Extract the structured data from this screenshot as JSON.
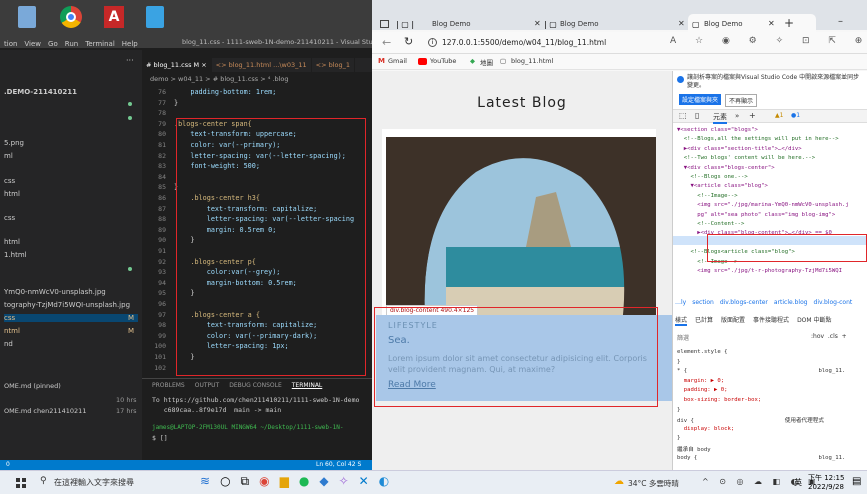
{
  "vscode": {
    "menu": [
      "tion",
      "View",
      "Go",
      "Run",
      "Terminal",
      "Help"
    ],
    "window_title": "blog_11.css - 1111-sweb-1N-demo-211410211 - Visual Studio Code",
    "explorer_header": ".DEMO-211410211",
    "explorer_items": [
      "5.png",
      "ml",
      "css",
      "html",
      "css",
      "html",
      "1.html",
      "YmQ0-nmWcV0-unsplash.jpg",
      "tography-TzjMd7i5WQI-unsplash.jpg",
      "css",
      "ntml",
      "nd",
      "OME.md (pinned)",
      "OME.md chen211410211"
    ],
    "explorer_badges": [
      "M",
      "M"
    ],
    "explorer_times": [
      "10 hrs",
      "17 hrs"
    ],
    "tabs": [
      {
        "label": "# blog_11.css M ×",
        "active": true
      },
      {
        "label": "<> blog_11.html ...\\w03_11",
        "active": false
      },
      {
        "label": "<> blog_1",
        "active": false
      }
    ],
    "breadcrumb": "demo > w04_11 > # blog_11.css > ⁴ .blog",
    "code_lines": [
      {
        "n": "76",
        "t": "    padding-bottom: 1rem;"
      },
      {
        "n": "77",
        "t": "}"
      },
      {
        "n": "78",
        "t": ""
      },
      {
        "n": "79",
        "t": ".blogs-center span{"
      },
      {
        "n": "80",
        "t": "    text-transform: uppercase;"
      },
      {
        "n": "81",
        "t": "    color: var(--primary);"
      },
      {
        "n": "82",
        "t": "    letter-spacing: var(--letter-spacing);"
      },
      {
        "n": "83",
        "t": "    font-weight: 500;"
      },
      {
        "n": "84",
        "t": ""
      },
      {
        "n": "85",
        "t": "}"
      },
      {
        "n": "86",
        "t": "    .blogs-center h3{"
      },
      {
        "n": "87",
        "t": "        text-transform: capitalize;"
      },
      {
        "n": "88",
        "t": "        letter-spacing: var(--letter-spacing"
      },
      {
        "n": "89",
        "t": "        margin: 0.5rem 0;"
      },
      {
        "n": "90",
        "t": "    }"
      },
      {
        "n": "91",
        "t": ""
      },
      {
        "n": "92",
        "t": "    .blogs-center p{"
      },
      {
        "n": "93",
        "t": "        color:var(--grey);"
      },
      {
        "n": "94",
        "t": "        margin-bottom: 0.5rem;"
      },
      {
        "n": "95",
        "t": "    }"
      },
      {
        "n": "96",
        "t": ""
      },
      {
        "n": "97",
        "t": "    .blogs-center a {"
      },
      {
        "n": "98",
        "t": "        text-transform: capitalize;"
      },
      {
        "n": "99",
        "t": "        color: var(--primary-dark);"
      },
      {
        "n": "100",
        "t": "        letter-spacing: 1px;"
      },
      {
        "n": "101",
        "t": "    }"
      },
      {
        "n": "102",
        "t": ""
      }
    ],
    "panel_tabs": [
      "PROBLEMS",
      "OUTPUT",
      "DEBUG CONSOLE",
      "TERMINAL"
    ],
    "terminal": [
      "To https://github.com/chen211410211/1111-sweb-1N-demo",
      "   c689caa..8f9e17d  main -> main",
      "",
      "james@LAPTOP-2FM130UL MINGW64 ~/Desktop/1111-sweb-1N-",
      "$ []"
    ],
    "status_right": "Ln 60, Col 42   S",
    "status_left": "0"
  },
  "edge": {
    "tabs": [
      "Blog Demo",
      "Blog Demo",
      "Blog Demo"
    ],
    "url": "127.0.0.1:5500/demo/w04_11/blog_11.html",
    "favorites": [
      "Gmail",
      "YouTube",
      "地圖",
      "blog_11.html"
    ],
    "page_title": "Latest Blog",
    "blog": {
      "tooltip": "div.blog-content  490.4×125",
      "category": "LIFESTYLE",
      "heading": "Sea.",
      "text": "Lorem ipsum dolor sit amet consectetur adipisicing elit. Corporis velit provident magnam. Qui, at maxime?",
      "link": "Read More"
    }
  },
  "devtools": {
    "notice": "讓剖析專案的檔案與Visual Studio Code 中開啟來源檔案並同步變更。",
    "notice_btn_primary": "設定檔案與夾",
    "notice_btn_secondary": "不再顯示",
    "tabs": [
      "元素",
      "»",
      "+"
    ],
    "badges": [
      "▲1",
      "●1"
    ],
    "dom_lines": [
      "▼<section class=\"blogs\">",
      "  <!--Blogs,all the settings will put in here-->",
      "  ▶<div class=\"section-title\">…</div>",
      "  <!--Two blogs' content will be here.-->",
      "  ▼<div class=\"blogs-center\">",
      "    <!--Blogs one.-->",
      "    ▼<article class=\"blog\">",
      "      <!--Image-->",
      "      <img src=\"./jpg/marina-YmQ0-nmWcV0-unsplash.j",
      "      pg\" alt=\"sea photo\" class=\"img blog-img\">",
      "      <!--Content-->",
      "      ▶<div class=\"blog-content\">…</div> == $0",
      "    </article>",
      "    <!--Blogs<article class=\"blog\">",
      "      <!--Image-->",
      "      <img src=\"./jpg/t-r-photography-TzjMd7i5WQI"
    ],
    "crumbs": [
      "…ly",
      "section",
      "div.blogs-center",
      "article.blog",
      "div.blog-cont"
    ],
    "lower_tabs": [
      "樣式",
      "已計算",
      "版面配置",
      "事件接聽程式",
      "DOM 中斷點"
    ],
    "filter": "篩選",
    "filter_right": ":hov  .cls  +",
    "styles": [
      "element.style {",
      "}",
      "* {                                       blog_11.",
      "  margin: ▶ 0;",
      "  padding: ▶ 0;",
      "  box-sizing: border-box;",
      "}",
      "div {                           使用者代理程式",
      "  display: block;",
      "}",
      "繼承自 body",
      "body {                                    blog_11."
    ]
  },
  "taskbar": {
    "search_placeholder": "在這裡輸入文字來搜尋",
    "weather": "34°C 多雲時晴",
    "time": "下午 12:15",
    "date": "2022/9/28",
    "ime": "英"
  }
}
